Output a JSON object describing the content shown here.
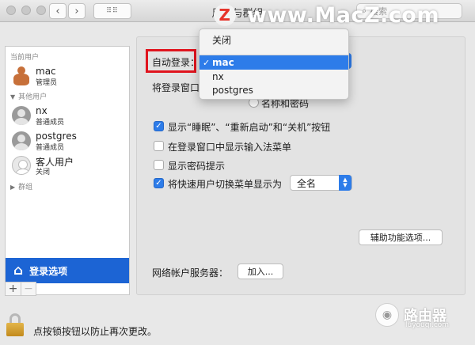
{
  "window": {
    "title": "用户与群组",
    "search_placeholder": "搜索"
  },
  "watermark": {
    "logo_letter": "Z",
    "text": "www.MacZ.com"
  },
  "sidebar": {
    "current_users_header": "当前用户",
    "other_users_header": "其他用户",
    "users": [
      {
        "name": "mac",
        "role": "管理员"
      },
      {
        "name": "nx",
        "role": "普通成员"
      },
      {
        "name": "postgres",
        "role": "普通成员"
      },
      {
        "name": "客人用户",
        "role": "关闭"
      }
    ],
    "groups_label": "群组",
    "login_options_label": "登录选项",
    "add_label": "+",
    "remove_label": "−"
  },
  "main": {
    "auto_login_label": "自动登录：",
    "auto_login_value": "mac",
    "login_window_label": "将登录窗口",
    "name_and_password_label": "名称和密码",
    "checkboxes": [
      {
        "label": "显示“睡眠”、“重新启动”和“关机”按钮",
        "checked": true
      },
      {
        "label": "在登录窗口中显示输入法菜单",
        "checked": false
      },
      {
        "label": "显示密码提示",
        "checked": false
      },
      {
        "label": "将快速用户切换菜单显示为",
        "checked": true
      }
    ],
    "fast_switch_value": "全名",
    "accessibility_button": "辅助功能选项...",
    "network_server_label": "网络帐户服务器：",
    "join_button": "加入..."
  },
  "dropdown": {
    "items": [
      "关闭",
      "mac",
      "nx",
      "postgres"
    ],
    "selected": "mac"
  },
  "footer": {
    "lock_text": "点按锁按钮以防止再次更改。"
  },
  "brand": {
    "name": "路由器",
    "url": "luyouqi.com"
  },
  "colors": {
    "accent": "#2d7ce9",
    "selection": "#1c64d4",
    "highlight_box": "#e0141e"
  }
}
